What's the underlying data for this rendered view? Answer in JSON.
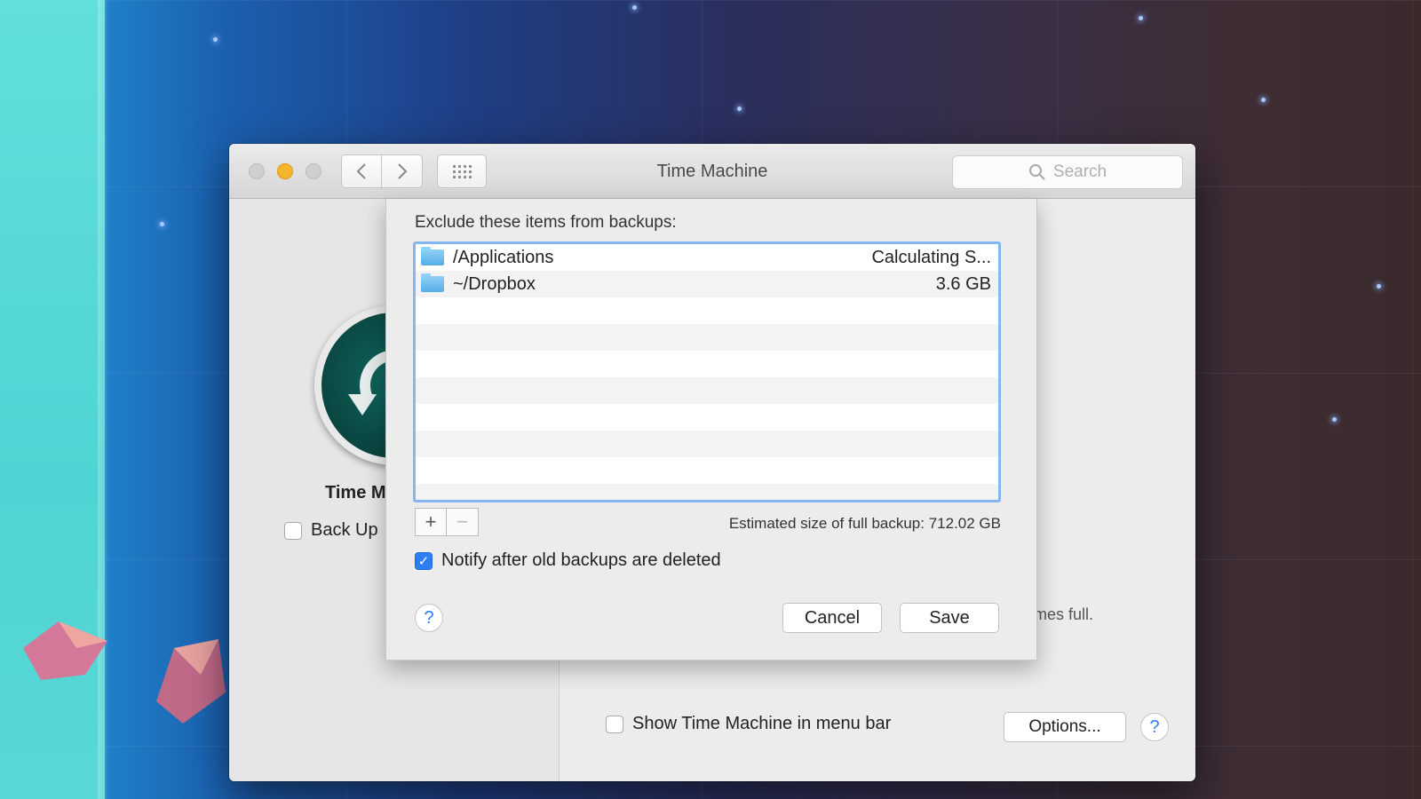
{
  "window": {
    "title": "Time Machine",
    "search_placeholder": "Search"
  },
  "background_pane": {
    "app_label": "Time M",
    "backup_checkbox_label": "Back Up",
    "partial_text": "mes full.",
    "show_in_menu_bar_label": "Show Time Machine in menu bar",
    "options_label": "Options...",
    "help_label": "?"
  },
  "sheet": {
    "heading": "Exclude these items from backups:",
    "items": [
      {
        "name": "/Applications",
        "size": "Calculating S..."
      },
      {
        "name": "~/Dropbox",
        "size": "3.6 GB"
      }
    ],
    "add_label": "+",
    "remove_label": "−",
    "estimated_size": "Estimated size of full backup: 712.02 GB",
    "notify_label": "Notify after old backups are deleted",
    "notify_checked": true,
    "help_label": "?",
    "cancel_label": "Cancel",
    "save_label": "Save"
  },
  "colors": {
    "accent": "#2d7df6",
    "list_focus_ring": "#84b6f2",
    "minimize": "#f6b52b",
    "tm_icon": "#0b4a45"
  }
}
